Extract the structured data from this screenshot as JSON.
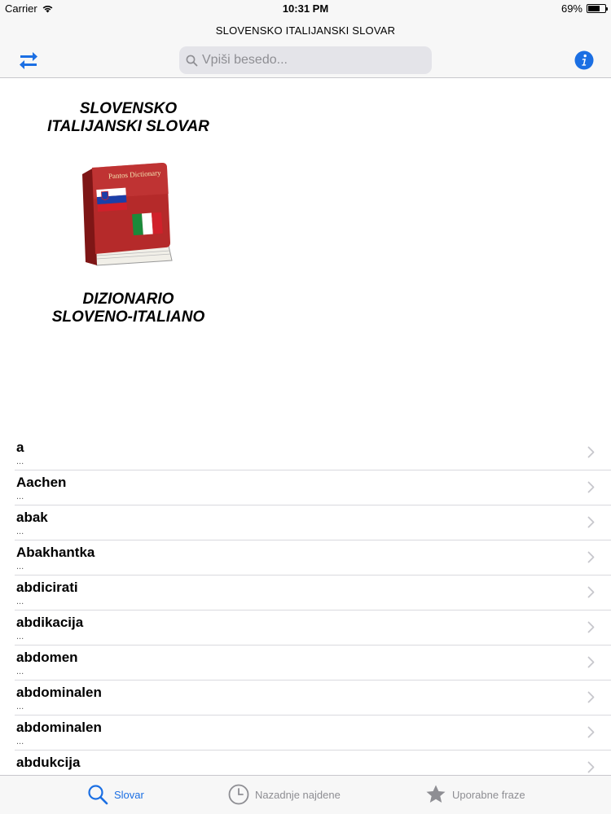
{
  "status_bar": {
    "carrier": "Carrier",
    "time": "10:31 PM",
    "battery_percent": "69%",
    "battery_level": 0.69
  },
  "nav": {
    "title": "SLOVENSKO ITALIJANSKI SLOVAR",
    "search_placeholder": "Vpiši besedo...",
    "search_value": "",
    "swap_icon": "swap-arrows-icon",
    "info_icon": "info-icon"
  },
  "hero": {
    "title_top_line1": "SLOVENSKO",
    "title_top_line2": "ITALIJANSKI SLOVAR",
    "book_label": "Pantos Dictionary",
    "title_bottom_line1": "DIZIONARIO",
    "title_bottom_line2": "SLOVENO-ITALIANO"
  },
  "words": [
    {
      "word": "a",
      "detail": "..."
    },
    {
      "word": "Aachen",
      "detail": "..."
    },
    {
      "word": "abak",
      "detail": "..."
    },
    {
      "word": "Abakhantka",
      "detail": "..."
    },
    {
      "word": "abdicirati",
      "detail": "..."
    },
    {
      "word": "abdikacija",
      "detail": "..."
    },
    {
      "word": "abdomen",
      "detail": "..."
    },
    {
      "word": "abdominalen",
      "detail": "..."
    },
    {
      "word": "abdominalen",
      "detail": "..."
    },
    {
      "word": "abdukcija",
      "detail": "..."
    }
  ],
  "tabs": {
    "slovar": "Slovar",
    "recent": "Nazadnje najdene",
    "phrases": "Uporabne fraze"
  },
  "colors": {
    "accent": "#1b6fe3",
    "inactive": "#8e8e93",
    "book_red": "#b52a2a"
  }
}
